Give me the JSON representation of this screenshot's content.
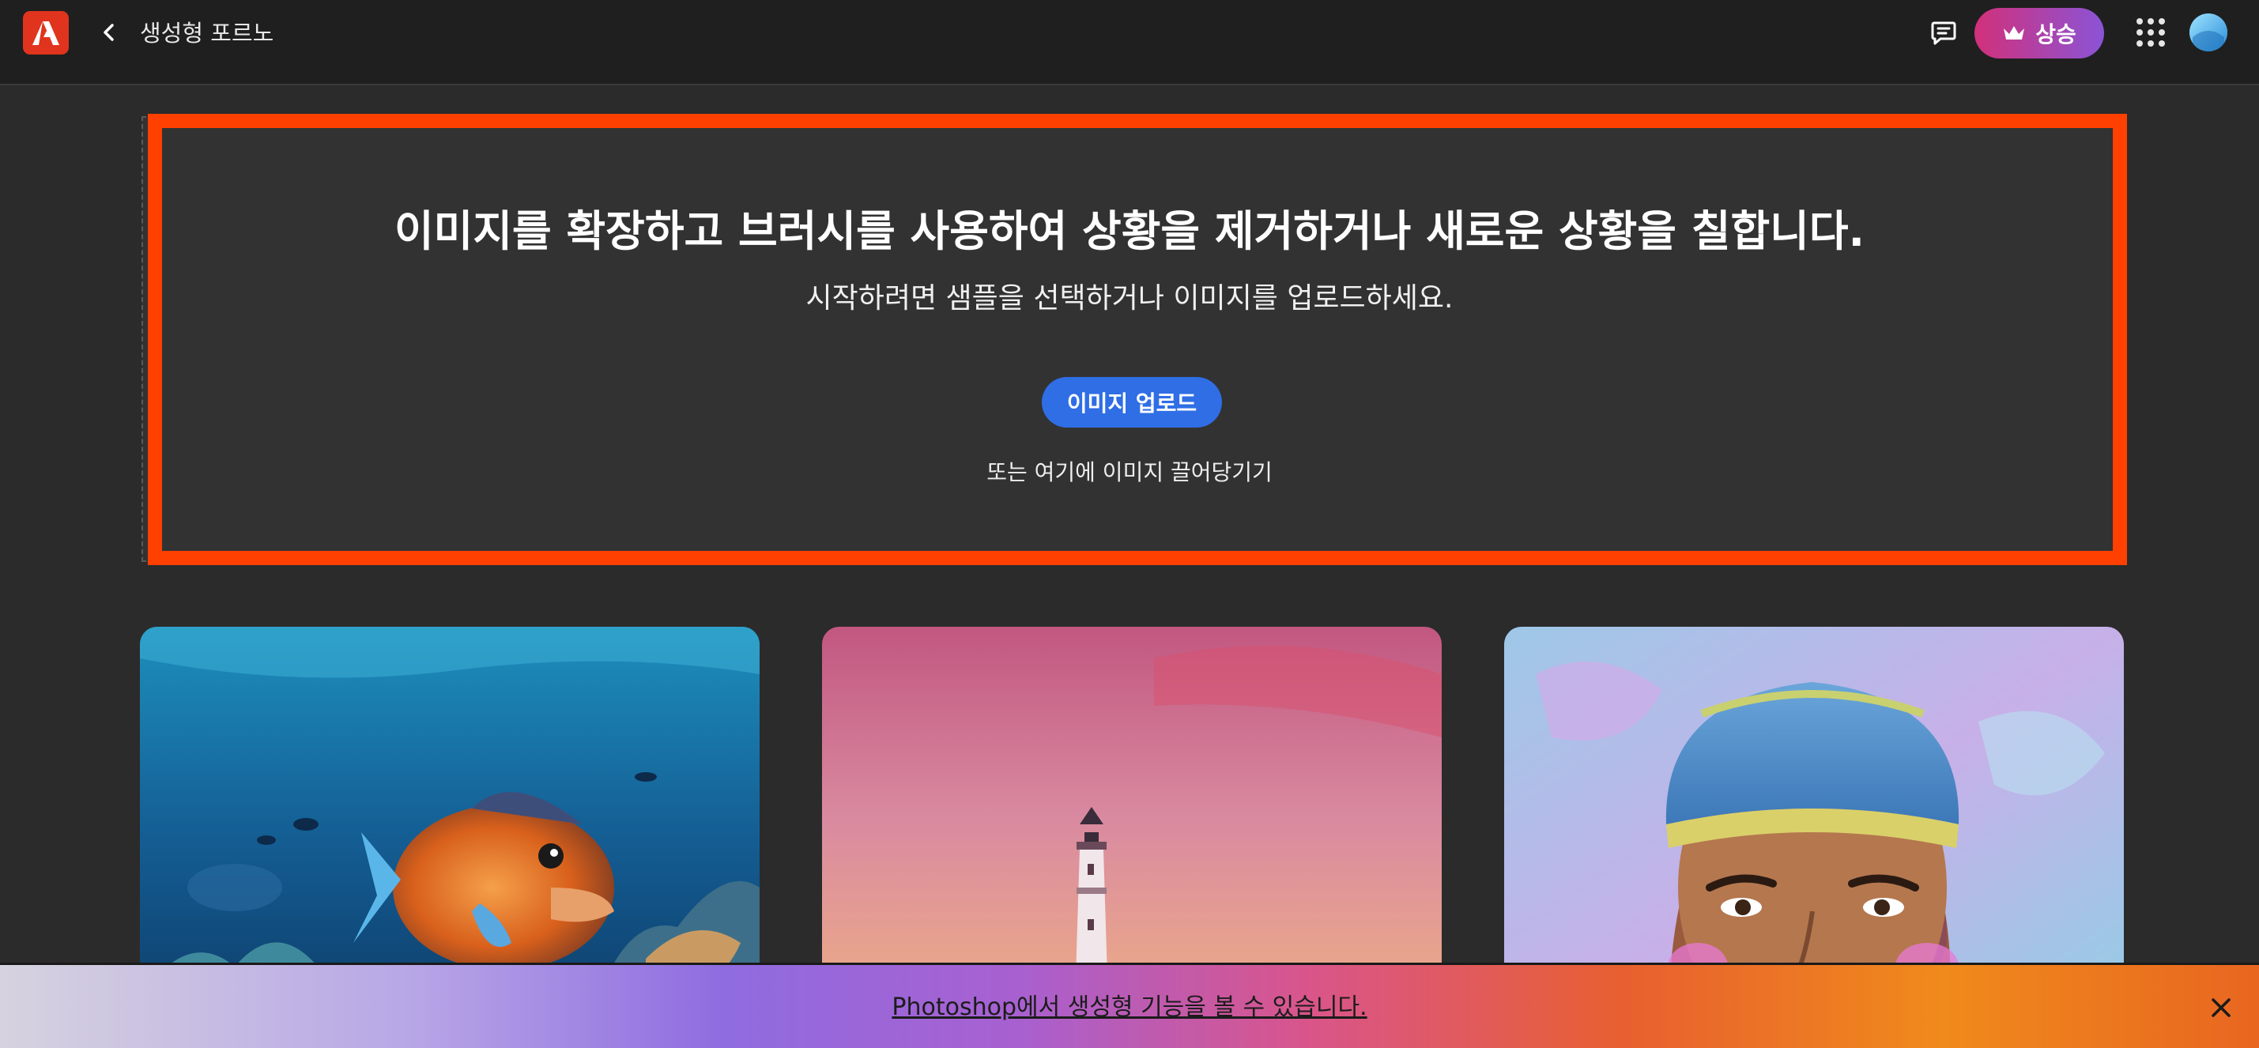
{
  "header": {
    "app_title": "생성형 포르노",
    "upgrade_label": "상승",
    "icons": {
      "logo": "adobe-express-logo",
      "back": "chevron-left-icon",
      "feedback": "chat-bubble-icon",
      "upgrade": "crown-icon",
      "apps": "app-grid-icon",
      "avatar": "user-avatar"
    }
  },
  "upload": {
    "headline": "이미지를 확장하고 브러시를 사용하여 상황을 제거하거나 새로운 상황을 칠합니다.",
    "subline": "시작하려면 샘플을 선택하거나 이미지를 업로드하세요.",
    "upload_button": "이미지 업로드",
    "drag_text": "또는 여기에 이미지 끌어당기기"
  },
  "samples": [
    {
      "subject": "fish-coral-reef"
    },
    {
      "subject": "lighthouse-sunset"
    },
    {
      "subject": "portrait-beanie"
    }
  ],
  "banner": {
    "text": "Photoshop에서 생성형 기능을 볼 수 있습니다.",
    "close_icon": "close-icon"
  },
  "colors": {
    "accent_blue": "#2f6ee5",
    "highlight_orange": "#ff4000",
    "logo_red": "#e0341e",
    "topbar_bg": "#1f1f1f",
    "canvas_bg": "#2b2b2b"
  }
}
